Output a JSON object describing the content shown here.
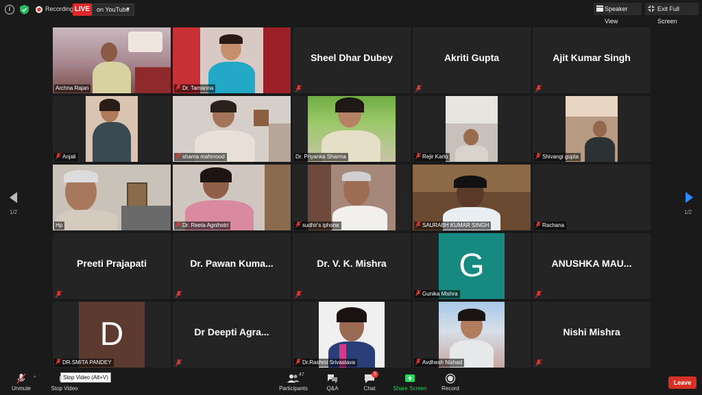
{
  "top_bar": {
    "recording_label": "Recording",
    "live_label": "LIVE",
    "stream_target": "on YouTube",
    "speaker_view_label": "Speaker View",
    "exit_fullscreen_label": "Exit Full Screen"
  },
  "pagination": {
    "left": "1/2",
    "right": "1/2"
  },
  "participants": [
    {
      "name": "Archna Rajan"
    },
    {
      "name": "Dr. Tamanna"
    },
    {
      "name": "Sheel Dhar Dubey"
    },
    {
      "name": "Akriti Gupta"
    },
    {
      "name": "Ajit Kumar Singh"
    },
    {
      "name": "Anjali"
    },
    {
      "name": "shama mahmood"
    },
    {
      "name": "Dr. Priyanka Sharma"
    },
    {
      "name": "Rejir Karlo"
    },
    {
      "name": "Shivangi gupta"
    },
    {
      "name": "Hp"
    },
    {
      "name": "Dr. Reeta Agnihotri"
    },
    {
      "name": "sudhir's iphone"
    },
    {
      "name": "SAURABH KUMAR SINGH"
    },
    {
      "name": "Rachana"
    },
    {
      "name": "Preeti Prajapati"
    },
    {
      "name": "Dr. Pawan Kuma..."
    },
    {
      "name": "Dr. V. K. Mishra"
    },
    {
      "name": "Gunika Mishra",
      "avatar": "G",
      "color": "#168a80"
    },
    {
      "name": "ANUSHKA MAU..."
    },
    {
      "name": "DR.SMITA PANDEY",
      "avatar": "D",
      "color": "#5c3a2f"
    },
    {
      "name": "Dr Deepti Agra..."
    },
    {
      "name": "Dr.Rashmi Srivastava"
    },
    {
      "name": "Avdhesh Nishad"
    },
    {
      "name": "Nishi Mishra"
    }
  ],
  "toolbar": {
    "unmute": "Unmute",
    "stop_video": "Stop Video",
    "stop_video_tooltip": "Stop Video (Alt+V)",
    "participants": "Participants",
    "participants_count": "47",
    "qa": "Q&A",
    "chat": "Chat",
    "chat_badge": "5",
    "share_screen": "Share Screen",
    "record": "Record",
    "leave": "Leave"
  },
  "colors": {
    "live_red": "#e02828",
    "share_green": "#23d959",
    "active_speaker": "#dddd55",
    "leave_red": "#d93025",
    "page_arrow_blue": "#2d8cff"
  }
}
